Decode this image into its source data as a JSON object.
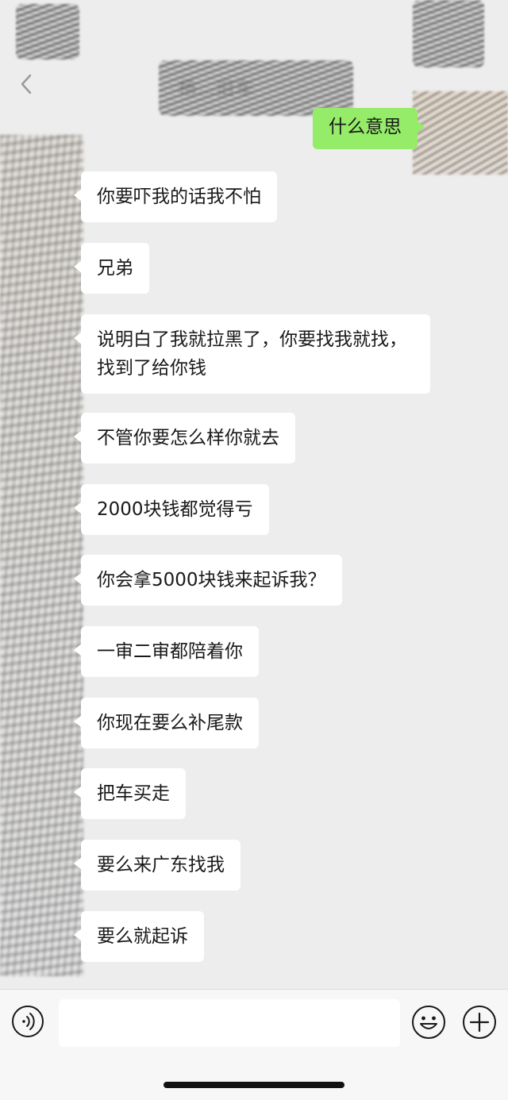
{
  "header": {
    "title": "杨…旧车"
  },
  "messages": [
    {
      "side": "right",
      "text": "什么意思"
    },
    {
      "side": "left",
      "text": "你要吓我的话我不怕"
    },
    {
      "side": "left",
      "text": "兄弟"
    },
    {
      "side": "left",
      "text": "说明白了我就拉黑了，你要找我就找，找到了给你钱"
    },
    {
      "side": "left",
      "text": "不管你要怎么样你就去"
    },
    {
      "side": "left",
      "text": "2000块钱都觉得亏"
    },
    {
      "side": "left",
      "text": "你会拿5000块钱来起诉我？"
    },
    {
      "side": "left",
      "text": "一审二审都陪着你"
    },
    {
      "side": "left",
      "text": "你现在要么补尾款"
    },
    {
      "side": "left",
      "text": "把车买走"
    },
    {
      "side": "left",
      "text": "要么来广东找我"
    },
    {
      "side": "left",
      "text": "要么就起诉"
    }
  ],
  "input": {
    "value": "",
    "placeholder": ""
  },
  "icons": {
    "back": "chevron-left-icon",
    "voice": "voice-icon",
    "emoji": "emoji-icon",
    "more": "plus-icon"
  },
  "colors": {
    "background": "#ededed",
    "bubble_left": "#ffffff",
    "bubble_right": "#95ec69",
    "input_bar": "#f7f7f7"
  }
}
